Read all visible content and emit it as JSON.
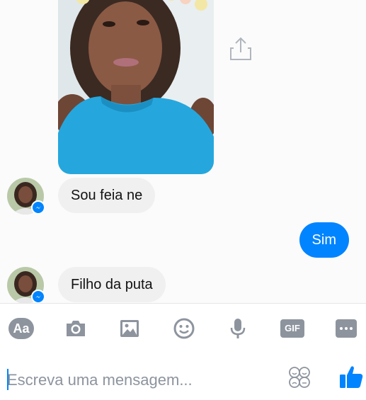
{
  "thread": {
    "messages": [
      {
        "from": "them",
        "text": "Sou feia ne"
      },
      {
        "from": "me",
        "text": "Sim"
      },
      {
        "from": "them",
        "text": "Filho da puta"
      }
    ],
    "photo_icon": "person-photo",
    "share_icon": "share-icon"
  },
  "toolbar": {
    "text_style_label": "Aa",
    "gif_label": "GIF",
    "icons": [
      "camera-icon",
      "gallery-icon",
      "emoji-icon",
      "microphone-icon",
      "more-icon"
    ]
  },
  "composer": {
    "placeholder": "Escreva uma mensagem...",
    "value": ""
  },
  "colors": {
    "accent": "#0084ff",
    "bubble_in": "#f0f0f0",
    "toolbar_icon": "#8d949e"
  }
}
